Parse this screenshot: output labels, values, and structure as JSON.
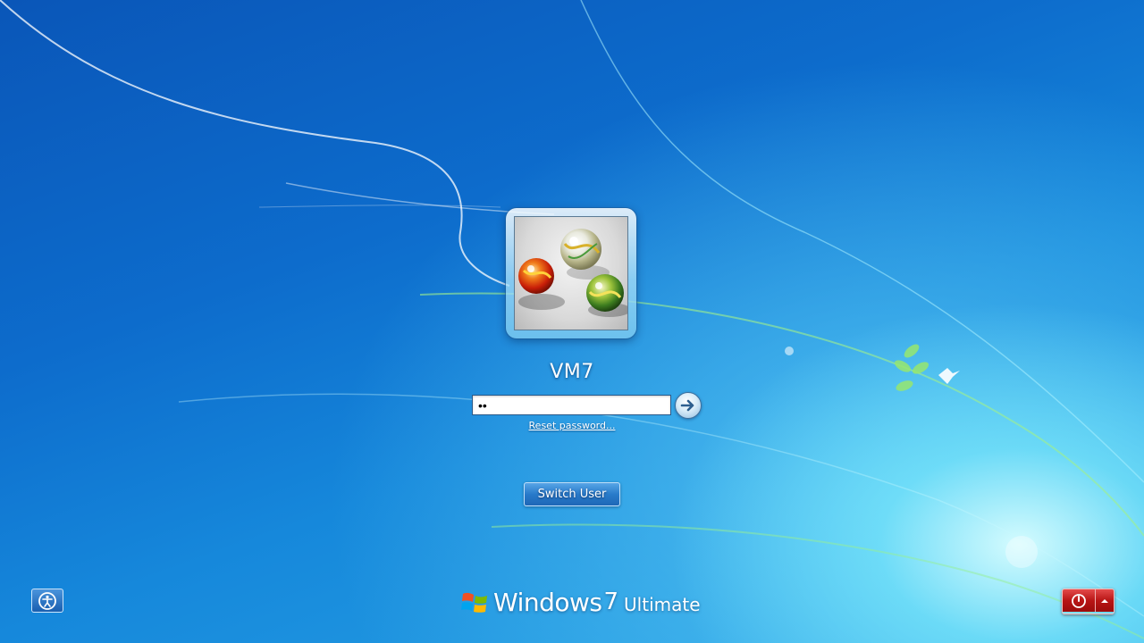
{
  "login": {
    "username": "VM7",
    "password_value": "••",
    "reset_link": "Reset password...",
    "switch_user": "Switch User"
  },
  "branding": {
    "name": "Windows",
    "version": "7",
    "edition": "Ultimate"
  },
  "colors": {
    "background_top": "#0a56b8",
    "background_glow": "#c8f6ff",
    "shutdown_red": "#b81515"
  },
  "icons": {
    "ease_of_access": "ease-of-access-icon",
    "submit": "arrow-right-icon",
    "shutdown": "power-icon",
    "options": "triangle-up-icon",
    "logo": "windows-flag-icon"
  }
}
